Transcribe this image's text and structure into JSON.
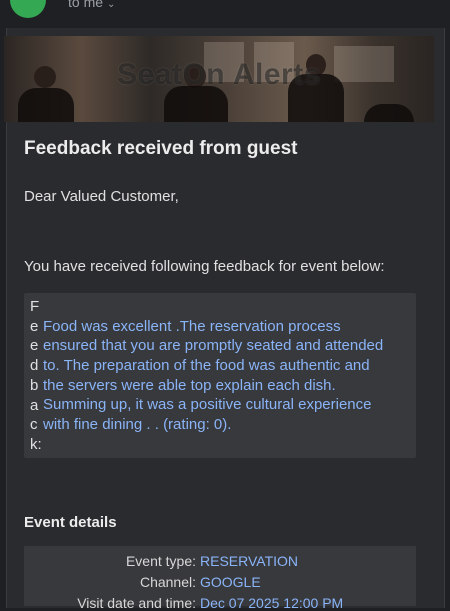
{
  "header": {
    "recipient": "to me",
    "avatar_color": "#34a853"
  },
  "banner": {
    "title": "SeatOn Alerts"
  },
  "email": {
    "title": "Feedback received from guest",
    "greeting": "Dear Valued Customer,",
    "intro": "You have received following feedback for event below:",
    "feedback_label_letters": [
      "F",
      "e",
      "e",
      "d",
      "b",
      "a",
      "c",
      "k:"
    ],
    "feedback_lines": [
      "Food was excellent .The reservation process",
      "ensured that you are promptly seated and attended",
      "to. The preparation of the food was authentic and",
      "the servers were able top explain each dish.",
      "Summing up, it was a positive cultural experience",
      "with fine dining . . (rating: 0)."
    ],
    "event_details_heading": "Event details",
    "event_details": [
      {
        "label": "Event type:",
        "value": "RESERVATION"
      },
      {
        "label": "Channel:",
        "value": "GOOGLE"
      },
      {
        "label": "Visit date and time:",
        "value": "Dec 07 2025 12:00 PM"
      }
    ]
  },
  "colors": {
    "background": "#1f2023",
    "card": "#2a2b2e",
    "box": "#38393c",
    "link": "#8ab4f8"
  }
}
